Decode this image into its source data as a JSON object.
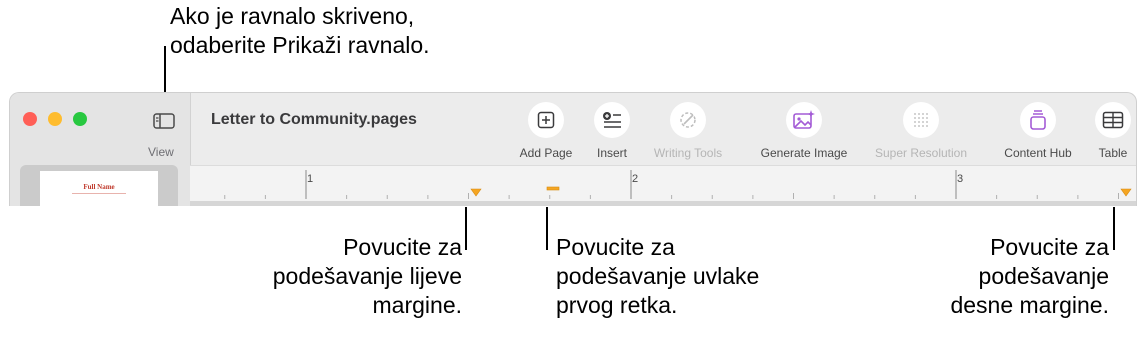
{
  "callouts": {
    "view": "Ako je ravnalo skriveno,\nodaberite Prikaži ravnalo.",
    "left_margin": "Povucite za\npodešavanje lijeve\nmargine.",
    "first_line": "Povucite za\npodešavanje uvlake\nprvog retka.",
    "right_margin": "Povucite za\npodešavanje\ndesne margine."
  },
  "window": {
    "document_title": "Letter to Community.pages",
    "sidebar": {
      "view_label": "View",
      "thumbnail_text": "Full Name"
    },
    "toolbar": {
      "add_page": "Add Page",
      "insert": "Insert",
      "writing_tools": "Writing Tools",
      "generate_image": "Generate Image",
      "super_resolution": "Super Resolution",
      "content_hub": "Content Hub",
      "table": "Table"
    },
    "ruler": {
      "labels": [
        "1",
        "2",
        "3"
      ]
    }
  },
  "colors": {
    "close": "#ff5f57",
    "minimize": "#febc2e",
    "zoom": "#28c840",
    "marker": "#f5a623",
    "accent_purple": "#a35bd6"
  }
}
